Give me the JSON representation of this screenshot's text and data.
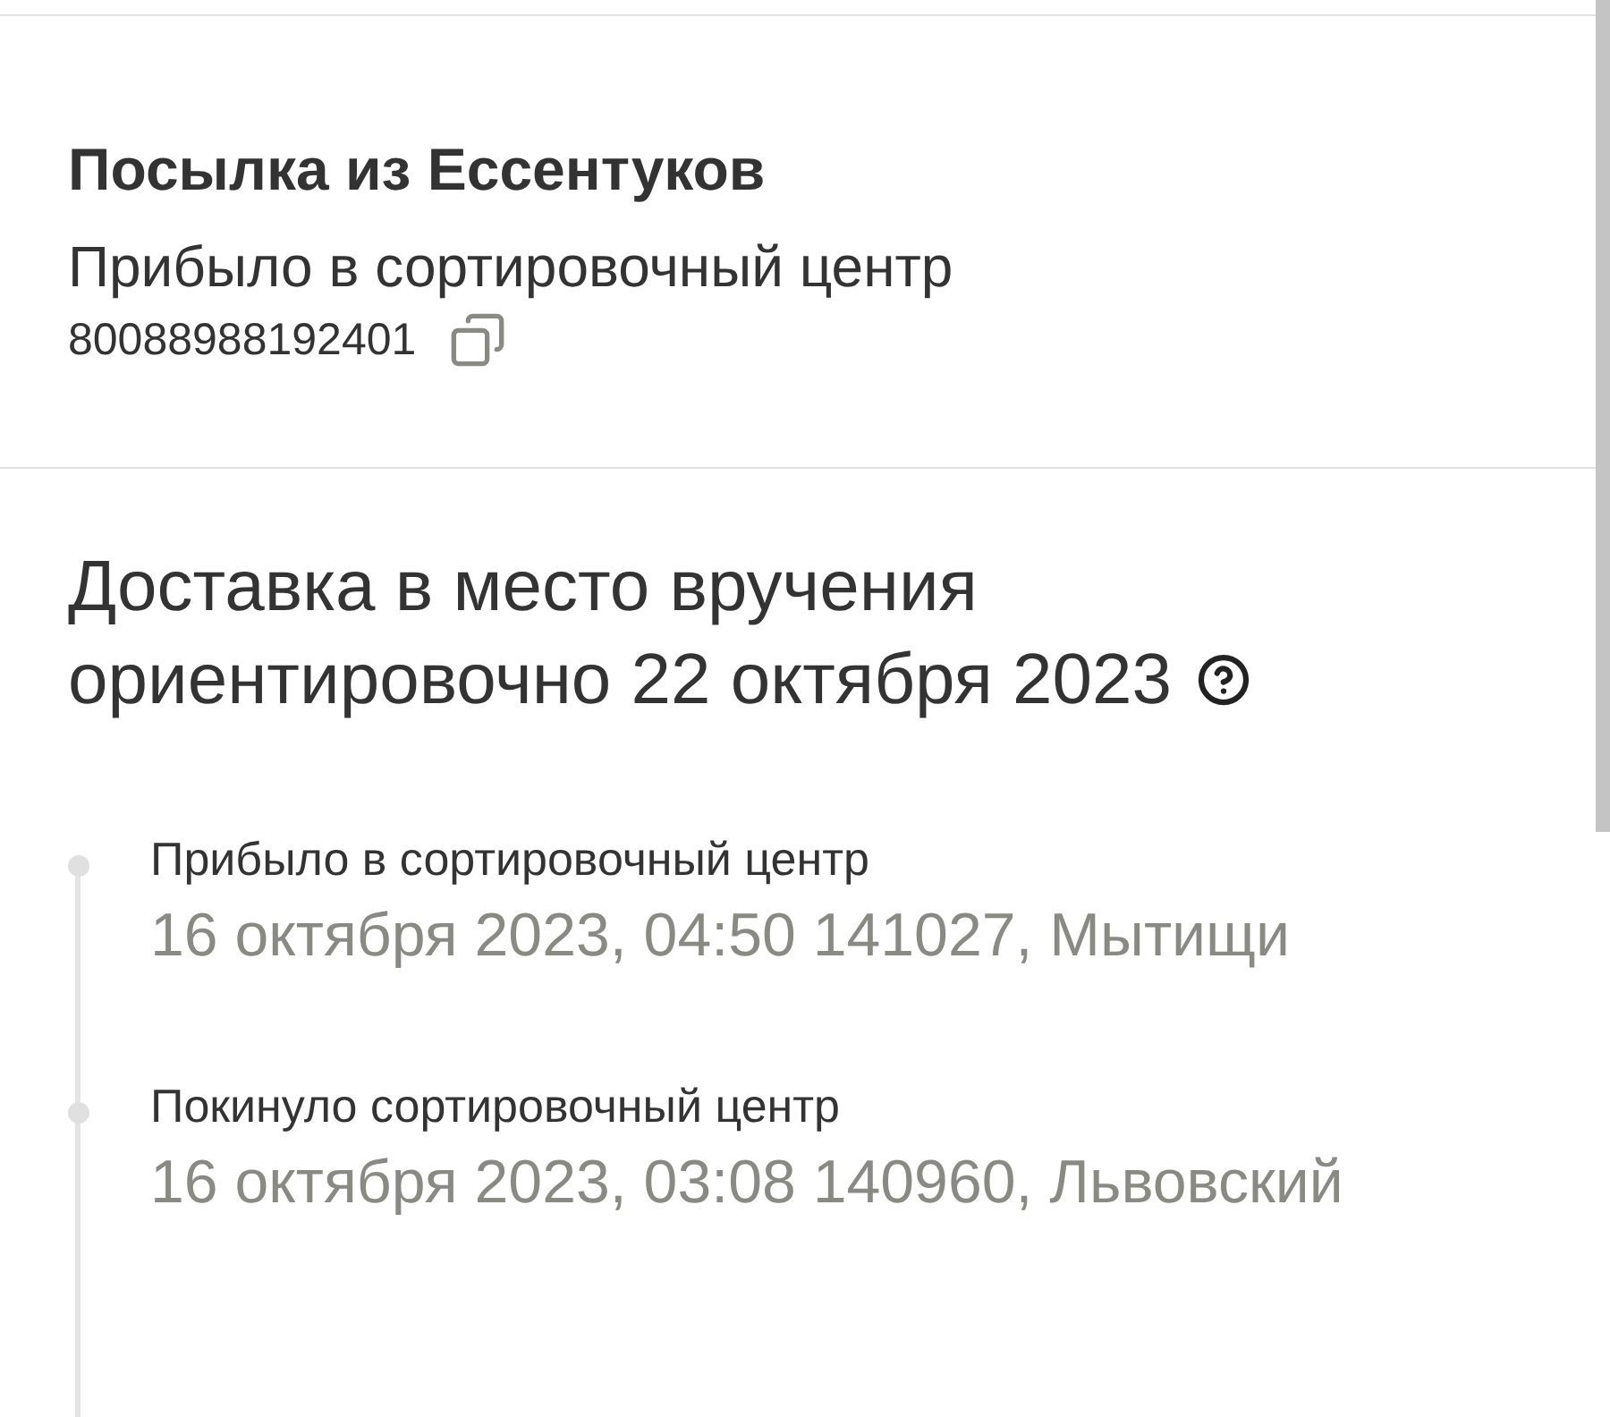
{
  "parcel": {
    "title": "Посылка из Ессентуков",
    "status": "Прибыло в сортировочный центр",
    "tracking_number": "80088988192401"
  },
  "delivery": {
    "line_1": "Доставка в место вручения",
    "line_2": "ориентировочно 22 октября 2023"
  },
  "events": [
    {
      "title": "Прибыло в сортировочный центр",
      "details": "16 октября 2023, 04:50 141027, Мытищи"
    },
    {
      "title": "Покинуло сортировочный центр",
      "details": "16 октября 2023, 03:08 140960, Львовский"
    }
  ]
}
